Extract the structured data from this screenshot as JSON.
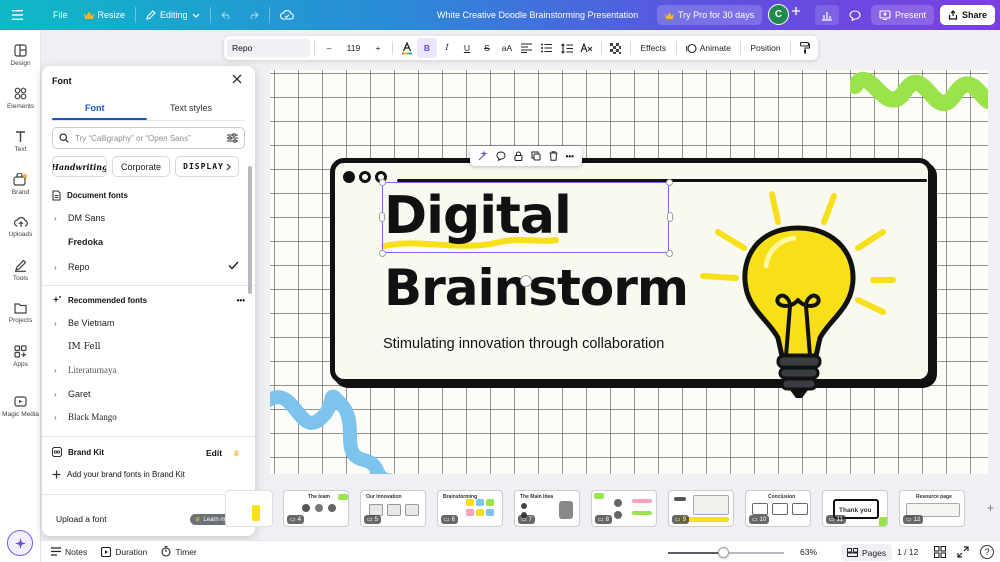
{
  "topbar": {
    "file": "File",
    "resize": "Resize",
    "mode": "Editing",
    "title": "White Creative Doodle Brainstorming Presentation",
    "pro": "Try Pro for 30 days",
    "avatar_initial": "C",
    "present": "Present",
    "share": "Share"
  },
  "rail": {
    "items": [
      "Design",
      "Elements",
      "Text",
      "Brand",
      "Uploads",
      "Tools",
      "Projects",
      "Apps",
      "Magic Media"
    ]
  },
  "panel": {
    "title": "Font",
    "tabs": [
      "Font",
      "Text styles"
    ],
    "search_placeholder": "Try “Calligraphy” or “Open Sans”",
    "chips": [
      "Handwriting",
      "Corporate",
      "DISPLAY"
    ],
    "document_heading": "Document fonts",
    "document_fonts": [
      "DM Sans",
      "Fredoka",
      "Repo"
    ],
    "recommended_heading": "Recommended fonts",
    "recommended_fonts": [
      "Be Vietnam",
      "IM Fell",
      "Literaturnaya",
      "Garet",
      "Black Mango"
    ],
    "brand_heading": "Brand Kit",
    "brand_edit": "Edit",
    "brand_add": "Add your brand fonts in Brand Kit",
    "upload": "Upload a font",
    "learn_more": "Learn more"
  },
  "toolbar": {
    "font": "Repo",
    "size": "119",
    "effects": "Effects",
    "animate": "Animate",
    "position": "Position"
  },
  "slide": {
    "title_line1": "Digital",
    "title_line2": "Brainstorm",
    "subtitle": "Stimulating innovation through collaboration"
  },
  "thumbnails": [
    {
      "num": "4",
      "label": "The team"
    },
    {
      "num": "5",
      "label": "Our Innovation"
    },
    {
      "num": "6",
      "label": "Brainstorming"
    },
    {
      "num": "7",
      "label": "The Main Idea"
    },
    {
      "num": "8",
      "label": ""
    },
    {
      "num": "9",
      "label": ""
    },
    {
      "num": "10",
      "label": "Conclusion"
    },
    {
      "num": "11",
      "label": "Thank you"
    },
    {
      "num": "12",
      "label": "Resource page"
    }
  ],
  "bottombar": {
    "notes": "Notes",
    "duration": "Duration",
    "timer": "Timer",
    "zoom": "63%",
    "zoom_value": 0.47,
    "pages": "Pages",
    "page_count": "1 / 12",
    "help": "?"
  },
  "colors": {
    "accent": "#8b5cf6",
    "bulb_yellow": "#f7e017",
    "squiggle_green": "#9be34a",
    "squiggle_blue": "#7cc4ee"
  }
}
